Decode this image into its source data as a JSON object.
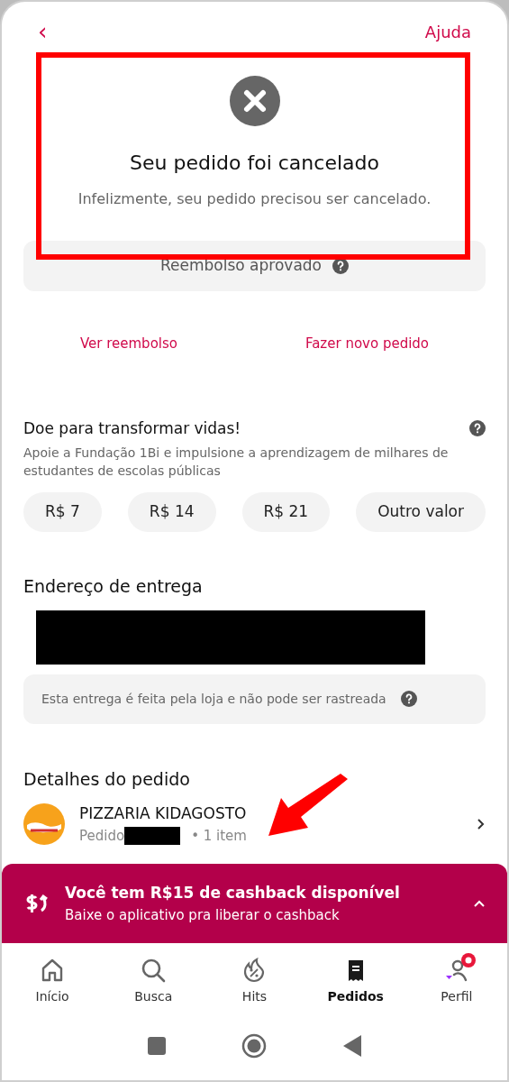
{
  "header": {
    "back": "‹",
    "help": "Ajuda"
  },
  "status": {
    "title": "Seu pedido foi cancelado",
    "subtitle": "Infelizmente, seu pedido precisou ser cancelado."
  },
  "refund": {
    "label": "Reembolso aprovado"
  },
  "actions": [
    "Ver reembolso",
    "Fazer novo pedido"
  ],
  "donation": {
    "title": "Doe para transformar vidas!",
    "description": "Apoie a Fundação 1Bi e impulsione a aprendizagem de milhares de estudantes de escolas públicas",
    "amounts": [
      "R$ 7",
      "R$ 14",
      "R$ 21",
      "Outro valor"
    ]
  },
  "address": {
    "title": "Endereço de entrega",
    "note": "Esta entrega é feita pela loja e não pode ser rastreada"
  },
  "details": {
    "title": "Detalhes do pedido",
    "store": "PIZZARIA KIDAGOSTO",
    "order_prefix": "Pedido",
    "items": "• 1 item"
  },
  "cashback": {
    "title": "Você tem R$15 de cashback disponível",
    "subtitle": "Baixe o aplicativo pra liberar o cashback"
  },
  "nav": [
    {
      "kind": "home",
      "label": "Início",
      "selected": false
    },
    {
      "kind": "search",
      "label": "Busca",
      "selected": false
    },
    {
      "kind": "hits",
      "label": "Hits",
      "selected": false
    },
    {
      "kind": "orders",
      "label": "Pedidos",
      "selected": true
    },
    {
      "kind": "profile",
      "label": "Perfil",
      "selected": false,
      "badge": true
    }
  ]
}
